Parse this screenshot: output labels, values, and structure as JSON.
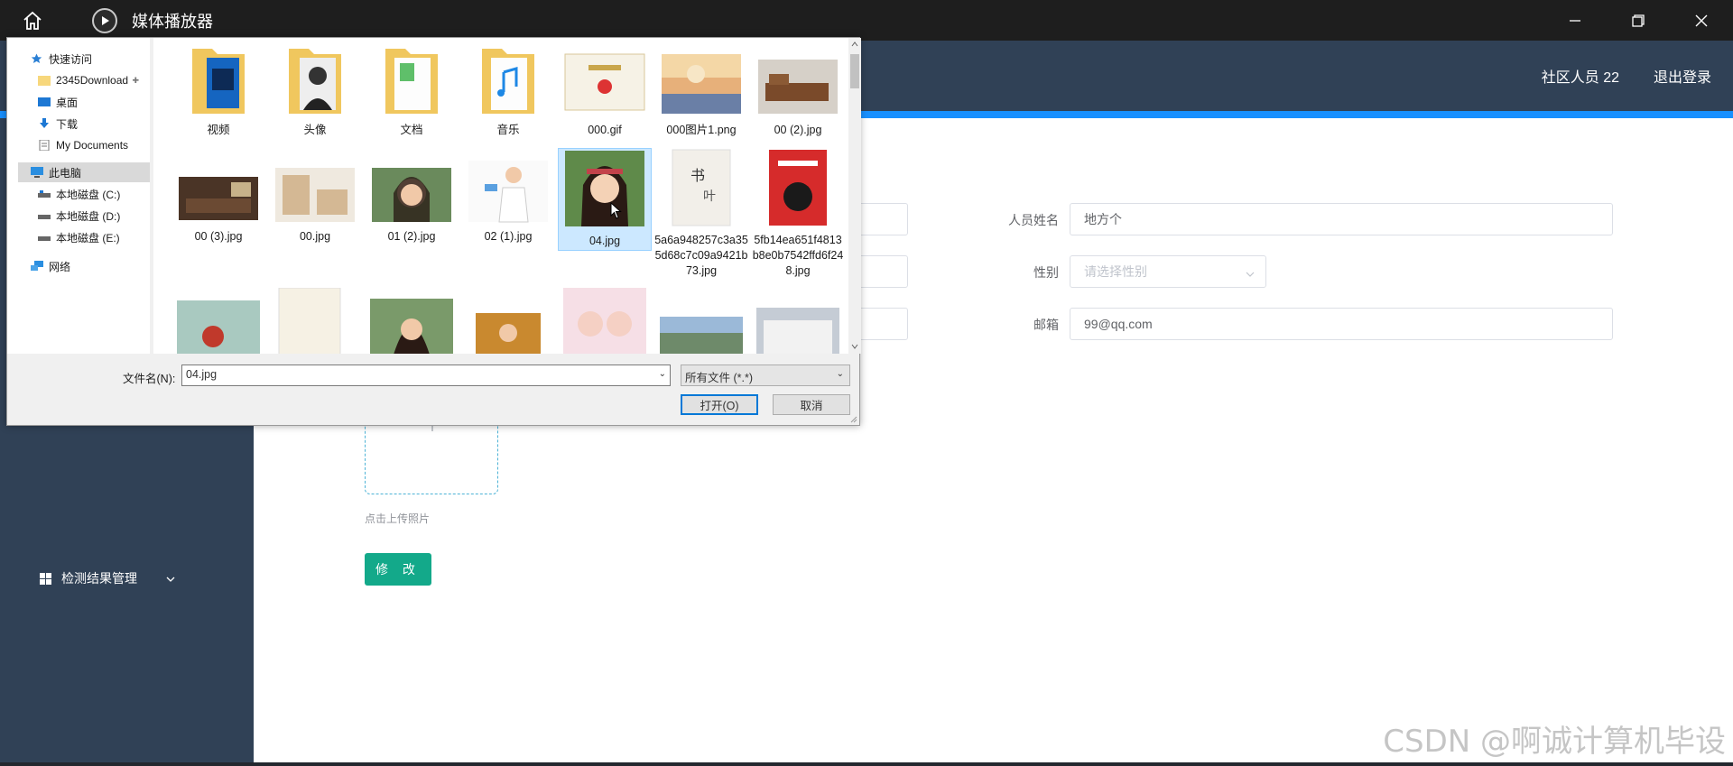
{
  "titlebar": {
    "title": "媒体播放器"
  },
  "header": {
    "user": "社区人员 22",
    "logout": "退出登录"
  },
  "sidebar": {
    "menu_item": "检测结果管理"
  },
  "form": {
    "name_label": "人员姓名",
    "name_value": "地方个",
    "gender_label": "性别",
    "gender_placeholder": "请选择性别",
    "email_label": "邮箱",
    "email_value": "99@qq.com",
    "upload_tip": "点击上传照片",
    "submit": "修 改"
  },
  "dialog": {
    "nav": [
      {
        "label": "快速访问",
        "icon": "star-icon"
      },
      {
        "label": "2345Download",
        "icon": "folder-icon",
        "pinned": true
      },
      {
        "label": "桌面",
        "icon": "desktop-icon",
        "pinned": true
      },
      {
        "label": "下载",
        "icon": "download-icon",
        "pinned": true
      },
      {
        "label": "My Documents",
        "icon": "documents-icon",
        "pinned": true
      },
      {
        "label": "此电脑",
        "icon": "computer-icon"
      },
      {
        "label": "本地磁盘 (C:)",
        "icon": "drive-icon"
      },
      {
        "label": "本地磁盘 (D:)",
        "icon": "drive-icon"
      },
      {
        "label": "本地磁盘 (E:)",
        "icon": "drive-icon"
      },
      {
        "label": "网络",
        "icon": "network-icon"
      }
    ],
    "files": [
      {
        "name": "视频",
        "kind": "folder"
      },
      {
        "name": "头像",
        "kind": "folder"
      },
      {
        "name": "文档",
        "kind": "folder"
      },
      {
        "name": "音乐",
        "kind": "folder"
      },
      {
        "name": "000.gif",
        "kind": "image"
      },
      {
        "name": "000图片1.png",
        "kind": "image"
      },
      {
        "name": "00 (2).jpg",
        "kind": "image"
      },
      {
        "name": "00 (3).jpg",
        "kind": "image"
      },
      {
        "name": "00.jpg",
        "kind": "image"
      },
      {
        "name": "01 (2).jpg",
        "kind": "image"
      },
      {
        "name": "02 (1).jpg",
        "kind": "image"
      },
      {
        "name": "04.jpg",
        "kind": "image",
        "selected": true
      },
      {
        "name": "5a6a948257c3a355d68c7c09a9421b73.jpg",
        "kind": "image"
      },
      {
        "name": "5fb14ea651f4813b8e0b7542ffd6f248.jpg",
        "kind": "image"
      }
    ],
    "filename_label": "文件名(N):",
    "filename_value": "04.jpg",
    "filetype": "所有文件 (*.*)",
    "open_button": "打开(O)",
    "cancel_button": "取消"
  },
  "watermark": "CSDN @啊诚计算机毕设",
  "colors": {
    "sidebar": "#304156",
    "accent": "#1890ff",
    "submit": "#13a98a",
    "titlebar": "#1e1e1e"
  }
}
